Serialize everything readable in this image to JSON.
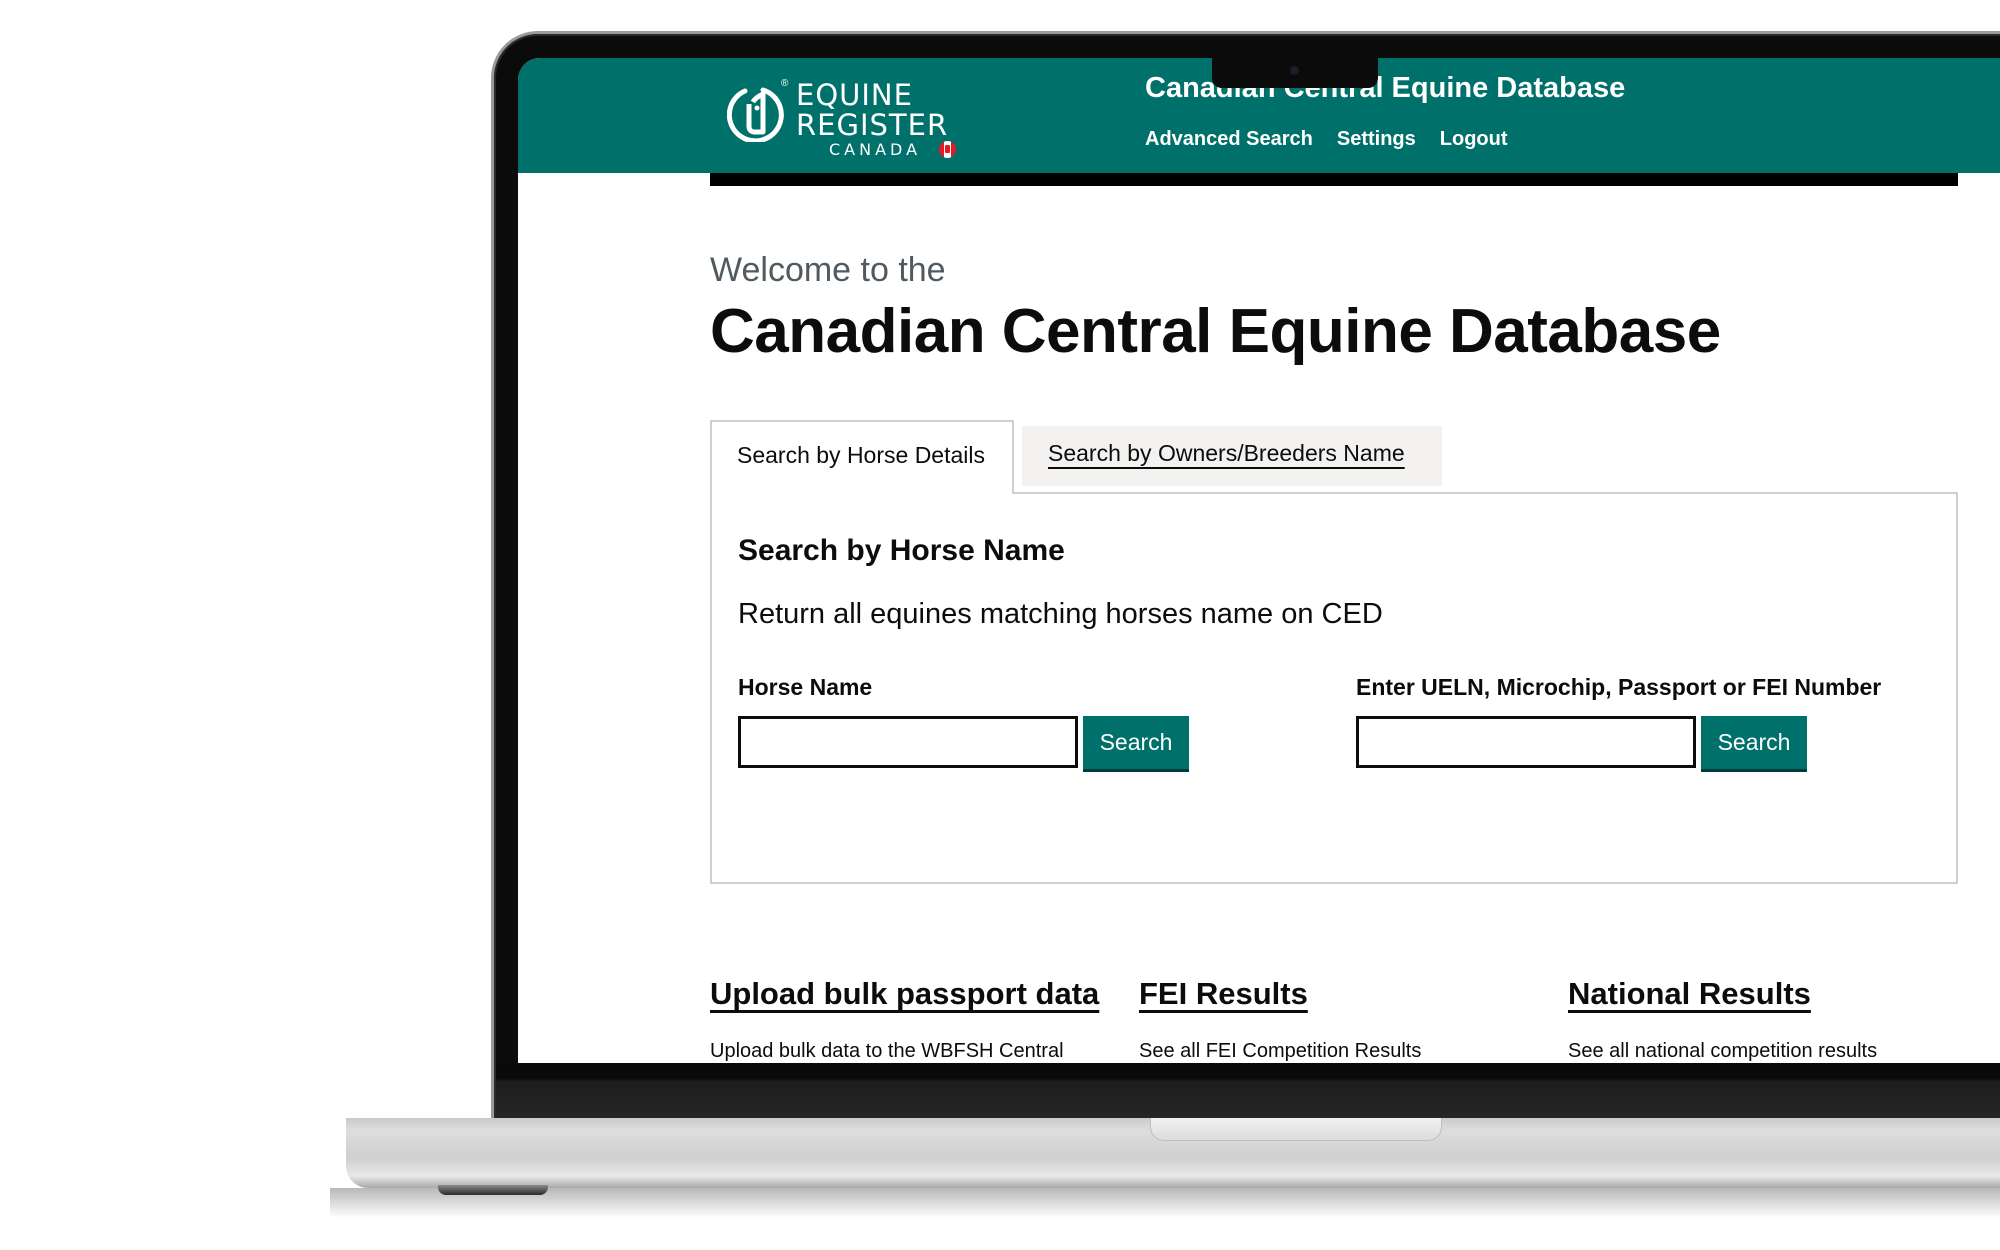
{
  "header": {
    "logo": {
      "line1": "EQUINE",
      "line2": "REGISTER",
      "line3": "CANADA",
      "registered": "®",
      "icon": "horse-head-logo-icon",
      "flag_icon": "canada-flag-icon"
    },
    "site_title": "Canadian Central Equine Database",
    "nav": [
      {
        "label": "Advanced Search"
      },
      {
        "label": "Settings"
      },
      {
        "label": "Logout"
      }
    ]
  },
  "main": {
    "welcome": "Welcome to the",
    "title": "Canadian Central Equine Database",
    "tabs": [
      {
        "label": "Search by Horse Details",
        "active": true
      },
      {
        "label": "Search by Owners/Breeders Name",
        "active": false
      }
    ],
    "panel": {
      "title": "Search by Horse Name",
      "description": "Return all equines matching horses name on CED",
      "fields": [
        {
          "label": "Horse Name",
          "value": "",
          "placeholder": "",
          "button": "Search"
        },
        {
          "label": "Enter UELN, Microchip, Passport or FEI Number",
          "value": "",
          "placeholder": "",
          "button": "Search"
        }
      ]
    },
    "links": [
      {
        "title": "Upload bulk passport data",
        "description": "Upload bulk data to the WBFSH Central"
      },
      {
        "title": "FEI Results",
        "description": "See all FEI Competition Results"
      },
      {
        "title": "National Results",
        "description": "See all national competition results"
      }
    ]
  },
  "colors": {
    "brand": "#00706a",
    "text": "#0b0c0c",
    "secondary_text": "#505a5f",
    "tab_inactive_bg": "#f3f2f1"
  }
}
